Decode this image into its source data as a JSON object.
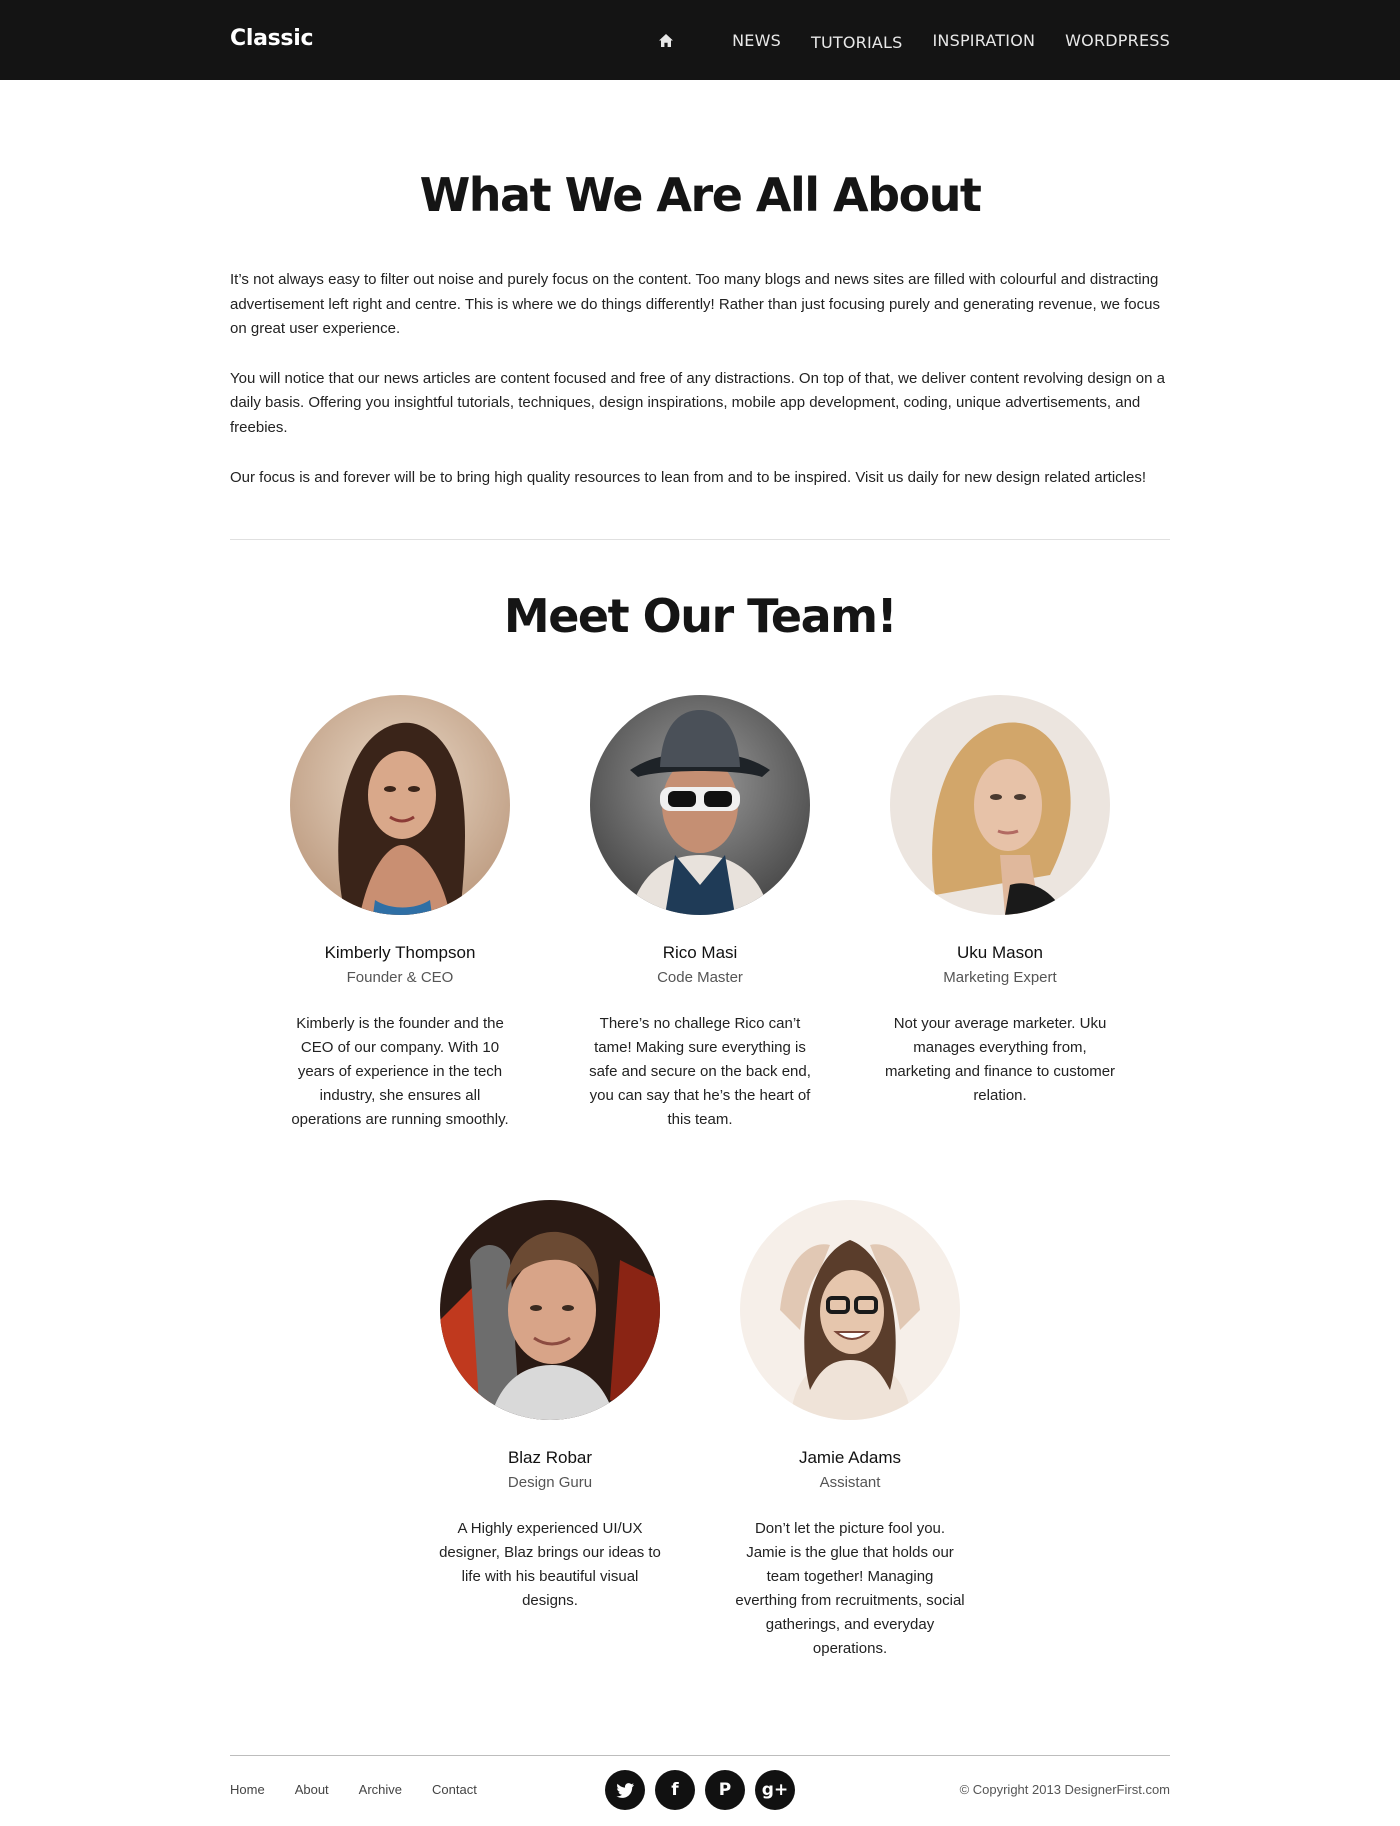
{
  "header": {
    "logo": "Classic",
    "nav": [
      {
        "label": "NEWS"
      },
      {
        "label": "TUTORIALS"
      },
      {
        "label": "INSPIRATION"
      },
      {
        "label": "WORDPRESS"
      }
    ],
    "home_icon": "home-icon"
  },
  "about": {
    "title": "What We Are All About",
    "paragraphs": [
      "It’s not always easy to filter out noise and purely focus on the content. Too many blogs and news sites are filled with colourful and distracting advertisement left right and centre. This is where we do things differently! Rather than just focusing purely and generating revenue, we focus on great user experience.",
      "You will notice that our news articles are content focused and free of any distractions. On top of that, we deliver content revolving design on a daily basis. Offering you insightful tutorials, techniques, design inspirations, mobile app development, coding, unique advertisements, and freebies.",
      "Our focus is and forever will be to bring high quality resources to lean from and to be inspired. Visit us daily for new design related articles!"
    ]
  },
  "team": {
    "title": "Meet Our Team!",
    "members": [
      {
        "name": "Kimberly Thompson",
        "role": "Founder & CEO",
        "bio": "Kimberly is the founder and the CEO of our company. With 10 years of experience in the tech industry, she ensures all operations are running smoothly."
      },
      {
        "name": "Rico Masi",
        "role": "Code Master",
        "bio": "There’s no challege Rico can’t tame! Making sure everything is safe and secure on the back end, you can say that he’s the heart of this team."
      },
      {
        "name": "Uku Mason",
        "role": "Marketing Expert",
        "bio": "Not your average marketer. Uku manages everything from, marketing and finance to customer relation."
      },
      {
        "name": "Blaz Robar",
        "role": "Design Guru",
        "bio": "A Highly experienced UI/UX designer, Blaz brings our ideas to life with his beautiful visual designs."
      },
      {
        "name": "Jamie Adams",
        "role": "Assistant",
        "bio": "Don’t let the picture fool you. Jamie is the glue that holds our team together! Managing everthing from recruitments, social gatherings, and everyday operations."
      }
    ]
  },
  "footer": {
    "links": [
      "Home",
      "About",
      "Archive",
      "Contact"
    ],
    "social": [
      {
        "icon": "twitter-icon"
      },
      {
        "icon": "facebook-icon",
        "glyph": "f"
      },
      {
        "icon": "pinterest-icon",
        "glyph": "P"
      },
      {
        "icon": "google-plus-icon",
        "glyph": "g+"
      }
    ],
    "copyright": "© Copyright 2013 DesignerFirst.com"
  }
}
